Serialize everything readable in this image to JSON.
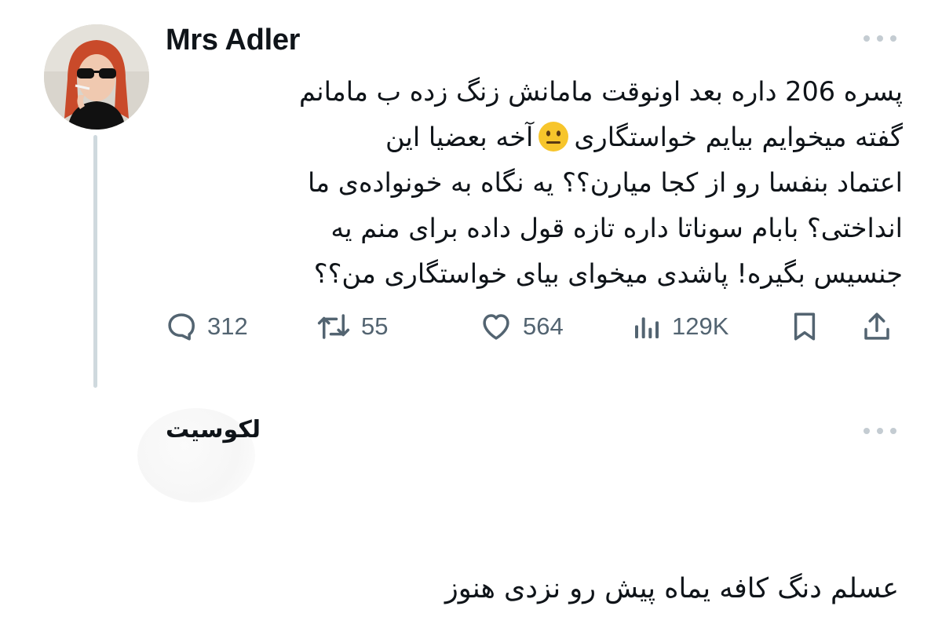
{
  "tweet": {
    "author_name": "Mrs Adler",
    "lines": [
      "پسره 206 داره بعد اونوقت مامانش زنگ زده ب مامانم",
      "گفته میخوایم بیایم خواستگاری",
      "آخه بعضیا این",
      "اعتماد بنفسا رو از کجا میارن؟؟ یه نگاه به خونواده‌ی ما",
      "انداختی؟ بابام سوناتا داره تازه قول داده برای منم یه",
      "جنسیس بگیره! پاشدی میخوای بیای خواستگاری من؟؟"
    ],
    "emoji": "neutral-face-emoji",
    "actions": {
      "reply_count": "312",
      "retweet_count": "55",
      "like_count": "564",
      "view_count": "129K"
    },
    "icons": {
      "reply": "comment-bubble-icon",
      "retweet": "retweet-icon",
      "like": "heart-icon",
      "views": "bar-chart-views-icon",
      "bookmark": "bookmark-icon",
      "share": "share-upload-icon"
    }
  },
  "reply": {
    "author_name": "لکوسیت",
    "text": "عسلم دنگ کافه یماه پیش رو نزدی هنوز"
  },
  "colors": {
    "text": "#0f1419",
    "secondary": "#536471",
    "thread_line": "#cfd9de",
    "more_dots": "#c4ccd2",
    "emoji_yellow": "#f7c52b"
  }
}
